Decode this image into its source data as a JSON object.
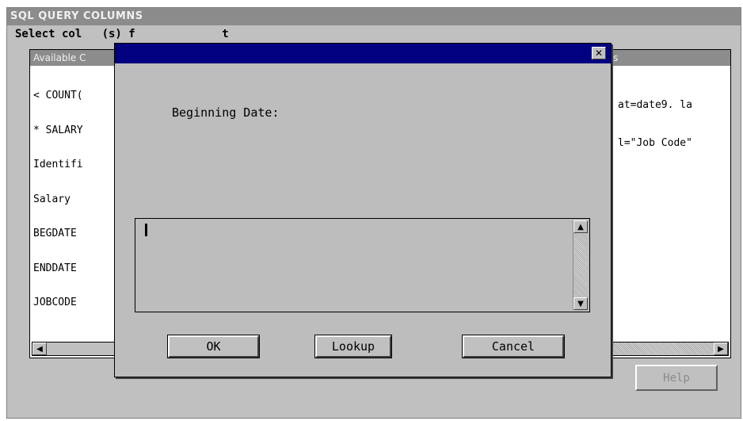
{
  "main_window": {
    "title": "SQL QUERY COLUMNS",
    "prompt": "Select col   (s) f             t",
    "available_panel": {
      "header": "Available C",
      "items": [
        "< COUNT(",
        "* SALARY",
        "Identifi",
        "Salary",
        "BEGDATE",
        "ENDDATE",
        "JOBCODE"
      ]
    },
    "selected_panel": {
      "header": "s",
      "items": [
        "at=date9. la",
        "l=\"Job Code\""
      ]
    },
    "help_label": "Help"
  },
  "dialog": {
    "title": "",
    "close_glyph": "✕",
    "label": "Beginning Date:",
    "input_value": "",
    "buttons": {
      "ok": "OK",
      "lookup": "Lookup",
      "cancel": "Cancel"
    }
  },
  "icons": {
    "up": "▲",
    "down": "▼",
    "left": "◀",
    "right": "▶"
  },
  "colors": {
    "dialog_titlebar": "#000080",
    "window_title_bg": "#8c8c8c",
    "window_bg": "#c0c0c0"
  }
}
